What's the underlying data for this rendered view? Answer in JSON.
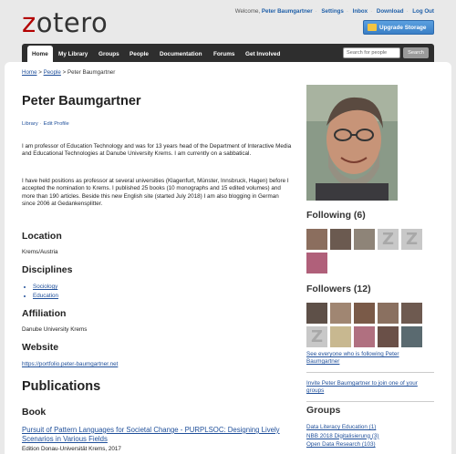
{
  "logo": {
    "text": "otero",
    "z": "z"
  },
  "user_links": {
    "welcome": "Welcome,",
    "user": "Peter Baumgartner",
    "settings": "Settings",
    "inbox": "Inbox",
    "download": "Download",
    "logout": "Log Out"
  },
  "upgrade_label": "Upgrade Storage",
  "nav": {
    "items": [
      "Home",
      "My Library",
      "Groups",
      "People",
      "Documentation",
      "Forums",
      "Get Involved"
    ],
    "search_placeholder": "Search for people",
    "search_button": "Search"
  },
  "breadcrumb": {
    "home": "Home",
    "sep1": ">",
    "people": "People",
    "sep2": ">",
    "current": "Peter Baumgartner"
  },
  "profile": {
    "name": "Peter Baumgartner",
    "library_link": "Library",
    "edit_link": "Edit Profile",
    "bio_1": "I am professor of Education Technology and was for 13 years head of the Department of Interactive Media and Educational Technologies at Danube University Krems. I am currently on a sabbatical.",
    "bio_2": "I have held positions as professor at several universities (Klagenfurt, Münster, Innsbruck, Hagen) before I accepted the nomination to Krems. I published 25 books (10 monographs and 15 edited volumes) and more than 190 articles. Beside this new English site (started July 2018) I am also blogging in German since 2006 at Gedankensplitter.",
    "location_heading": "Location",
    "location": "Krems/Austria",
    "disciplines_heading": "Disciplines",
    "disciplines": [
      "Sociology",
      "Education"
    ],
    "affiliation_heading": "Affiliation",
    "affiliation": "Danube University Krems",
    "website_heading": "Website",
    "website": "https://portfolio.peter-baumgartner.net"
  },
  "publications": {
    "heading": "Publications",
    "book_heading": "Book",
    "book_title": "Pursuit of Pattern Languages for Societal Change - PURPLSOC: Designing Lively Scenarios in Various Fields",
    "book_edition": "Edition Donau-Universität Krems, 2017"
  },
  "following": {
    "heading": "Following (6)"
  },
  "followers": {
    "heading": "Followers (12)",
    "see_everyone": "See everyone who is following Peter Baumgartner",
    "invite": "Invite Peter Baumgartner to join one of your groups"
  },
  "groups": {
    "heading": "Groups",
    "items": [
      "Data Literacy Education (1)",
      "NBB 2018 Digitalisierung (3)",
      "Open Data Research (103)"
    ]
  }
}
